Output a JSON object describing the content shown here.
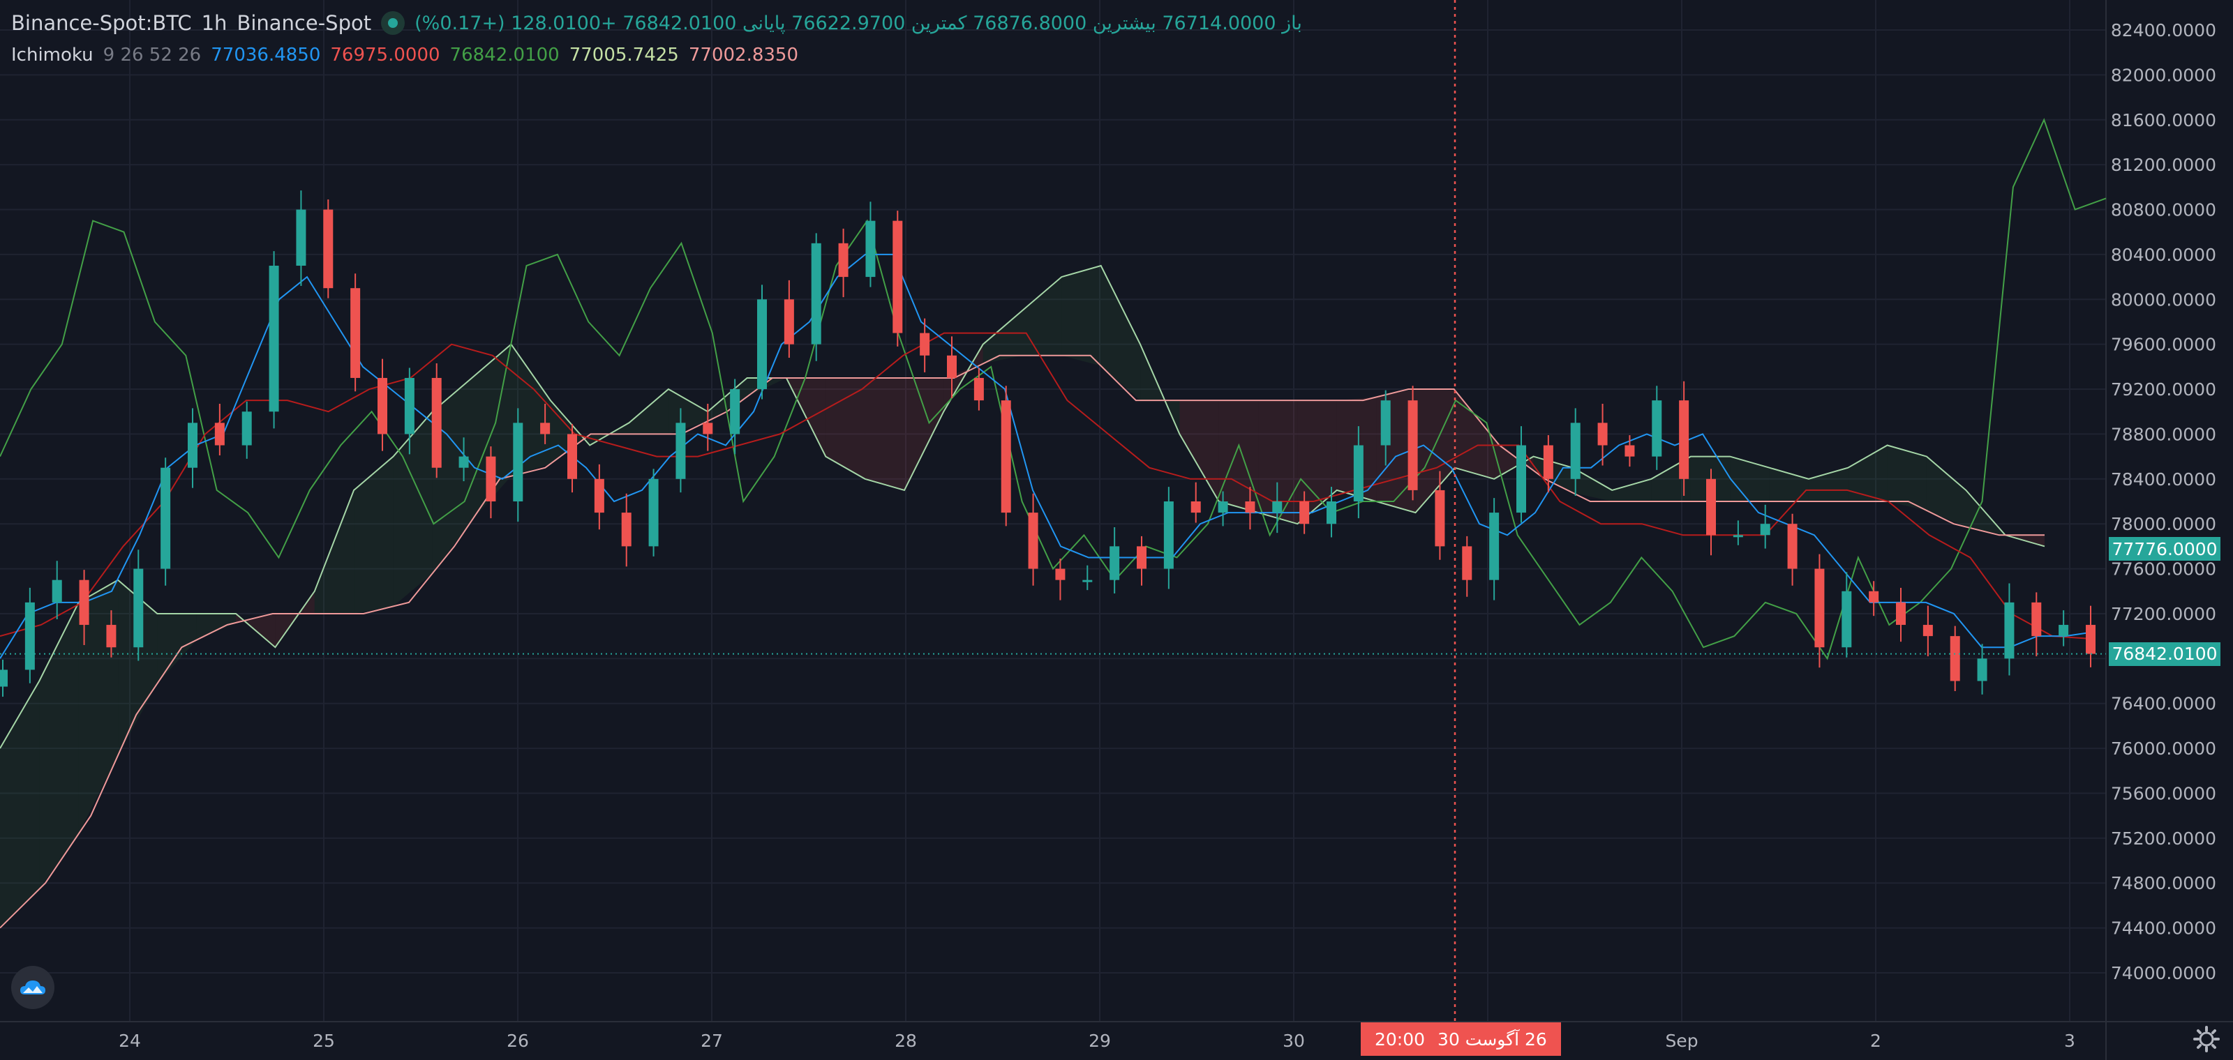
{
  "header": {
    "symbol": "Binance-Spot:BTC",
    "interval": "1h",
    "exchange": "Binance-Spot",
    "ohlc": {
      "open_label": "باز",
      "open": "76714.0000",
      "high_label": "بیشترین",
      "high": "76876.8000",
      "low_label": "کمترین",
      "low": "76622.9700",
      "close_label": "پایانی",
      "close": "76842.0100",
      "change": "+128.0100 (+0.17%)"
    }
  },
  "ichimoku": {
    "name": "Ichimoku",
    "params": "9 26 52 26",
    "conversion": "77036.4850",
    "base": "76975.0000",
    "lagging": "76842.0100",
    "lead1": "77005.7425",
    "lead2": "77002.8350"
  },
  "price_axis": {
    "labels": [
      "82400.0000",
      "82000.0000",
      "81600.0000",
      "81200.0000",
      "80800.0000",
      "80400.0000",
      "80000.0000",
      "79600.0000",
      "79200.0000",
      "78800.0000",
      "78400.0000",
      "78000.0000",
      "77600.0000",
      "77200.0000",
      "76800.0000",
      "76400.0000",
      "76000.0000",
      "75600.0000",
      "75200.0000",
      "74800.0000",
      "74400.0000",
      "74000.0000"
    ],
    "current_price_tag": "76842.0100",
    "crosshair_price_tag": "77776.0000"
  },
  "time_axis": {
    "labels": [
      "24",
      "25",
      "26",
      "27",
      "28",
      "29",
      "30",
      "Sep",
      "2",
      "3"
    ],
    "crosshair_time_tag": {
      "time": "20:00",
      "date": "26 آگوست 30"
    }
  },
  "colors": {
    "background": "#131722",
    "up": "#26a69a",
    "down": "#ef5350",
    "conversion_line": "#2196f3",
    "base_line": "#b71c1c",
    "lagging_span": "#43a047",
    "lead1": "#a5d6a7",
    "lead2": "#ef9a9a",
    "grid": "#1f2331"
  },
  "icons": {
    "status": "status-dot-icon",
    "logo": "cloud-logo-icon",
    "settings": "gear-icon"
  },
  "chart_data": {
    "type": "candlestick",
    "title": "Binance-Spot:BTC · 1h · Binance-Spot",
    "ylim": [
      73800,
      82600
    ],
    "x_day_ticks": [
      "24",
      "25",
      "26",
      "27",
      "28",
      "29",
      "30",
      "Sep",
      "2",
      "3"
    ],
    "crosshair": {
      "time": "20:00 26 Aug",
      "price": 77776.0
    },
    "last_price": 76842.01,
    "series": [
      {
        "name": "Close (approx, every ~3h)",
        "values": [
          76700,
          77300,
          77500,
          77100,
          76900,
          77600,
          78500,
          78900,
          78700,
          79000,
          80300,
          80800,
          80100,
          79300,
          78800,
          79300,
          78500,
          78600,
          78200,
          78900,
          78800,
          78400,
          78100,
          77800,
          78400,
          78900,
          78800,
          79200,
          80000,
          79600,
          80500,
          80200,
          80700,
          79700,
          79500,
          79300,
          79100,
          78100,
          77600,
          77500,
          77500,
          77800,
          77600,
          78200,
          78100,
          78200,
          78100,
          78200,
          78000,
          78200,
          78700,
          79100,
          78300,
          77800,
          77500,
          78100,
          78700,
          78400,
          78900,
          78700,
          78600,
          79100,
          78400,
          77900,
          77900,
          78000,
          77600,
          76900,
          77400,
          77300,
          77100,
          77000,
          76600,
          76800,
          77300,
          77000,
          77100,
          76842
        ]
      },
      {
        "name": "Tenkan (conversion)",
        "values": [
          76800,
          77200,
          77300,
          77300,
          77400,
          77900,
          78500,
          78700,
          78800,
          79400,
          80000,
          80200,
          79800,
          79400,
          79200,
          79000,
          78800,
          78500,
          78400,
          78600,
          78700,
          78500,
          78200,
          78300,
          78600,
          78800,
          78700,
          79000,
          79600,
          79800,
          80200,
          80400,
          80400,
          79800,
          79600,
          79400,
          79200,
          78300,
          77800,
          77700,
          77700,
          77700,
          77700,
          78000,
          78100,
          78100,
          78100,
          78100,
          78200,
          78300,
          78600,
          78700,
          78500,
          78000,
          77900,
          78100,
          78500,
          78500,
          78700,
          78800,
          78700,
          78800,
          78400,
          78100,
          78000,
          77900,
          77600,
          77300,
          77300,
          77300,
          77200,
          76900,
          76900,
          77000,
          77000,
          77036
        ]
      },
      {
        "name": "Kijun (base)",
        "values": [
          77000,
          77100,
          77300,
          77800,
          78200,
          78800,
          79100,
          79100,
          79000,
          79200,
          79300,
          79600,
          79500,
          79200,
          78800,
          78700,
          78600,
          78600,
          78700,
          78800,
          79000,
          79200,
          79500,
          79700,
          79700,
          79700,
          79100,
          78800,
          78500,
          78400,
          78400,
          78200,
          78200,
          78300,
          78400,
          78500,
          78700,
          78700,
          78200,
          78000,
          78000,
          77900,
          77900,
          77900,
          78300,
          78300,
          78200,
          77900,
          77700,
          77200,
          77000,
          76975
        ]
      },
      {
        "name": "Chikou (lagging)",
        "values": [
          78600,
          79200,
          79600,
          80700,
          80600,
          79800,
          79500,
          78300,
          78100,
          77700,
          78300,
          78700,
          79000,
          78600,
          78000,
          78200,
          78900,
          80300,
          80400,
          79800,
          79500,
          80100,
          80500,
          79700,
          78200,
          78600,
          79300,
          80300,
          80700,
          79700,
          78900,
          79200,
          79400,
          78200,
          77600,
          77900,
          77500,
          77800,
          77700,
          78000,
          78700,
          77900,
          78400,
          78100,
          78200,
          78200,
          78500,
          79100,
          78900,
          77900,
          77500,
          77100,
          77300,
          77700,
          77400,
          76900,
          77000,
          77300,
          77200,
          76800,
          77700,
          77100,
          77300,
          77600,
          78200,
          81000,
          81600,
          80800,
          80900
        ]
      },
      {
        "name": "Senkou A (lead 1)",
        "values": [
          76000,
          76600,
          77300,
          77500,
          77200,
          77200,
          77200,
          76900,
          77400,
          78300,
          78600,
          79000,
          79300,
          79600,
          79100,
          78700,
          78900,
          79200,
          79000,
          79300,
          79300,
          78600,
          78400,
          78300,
          79000,
          79600,
          79900,
          80200,
          80300,
          79600,
          78800,
          78200,
          78100,
          78000,
          78300,
          78200,
          78100,
          78500,
          78400,
          78600,
          78500,
          78300,
          78400,
          78600,
          78600,
          78500,
          78400,
          78500,
          78700,
          78600,
          78300,
          77900,
          77800
        ]
      },
      {
        "name": "Senkou B (lead 2)",
        "values": [
          74400,
          74800,
          75400,
          76300,
          76900,
          77100,
          77200,
          77200,
          77200,
          77300,
          77800,
          78400,
          78500,
          78800,
          78800,
          78800,
          79000,
          79300,
          79300,
          79300,
          79300,
          79300,
          79500,
          79500,
          79500,
          79100,
          79100,
          79100,
          79100,
          79100,
          79100,
          79200,
          79200,
          78700,
          78400,
          78200,
          78200,
          78200,
          78200,
          78200,
          78200,
          78200,
          78200,
          78000,
          77900,
          77900
        ]
      }
    ]
  }
}
